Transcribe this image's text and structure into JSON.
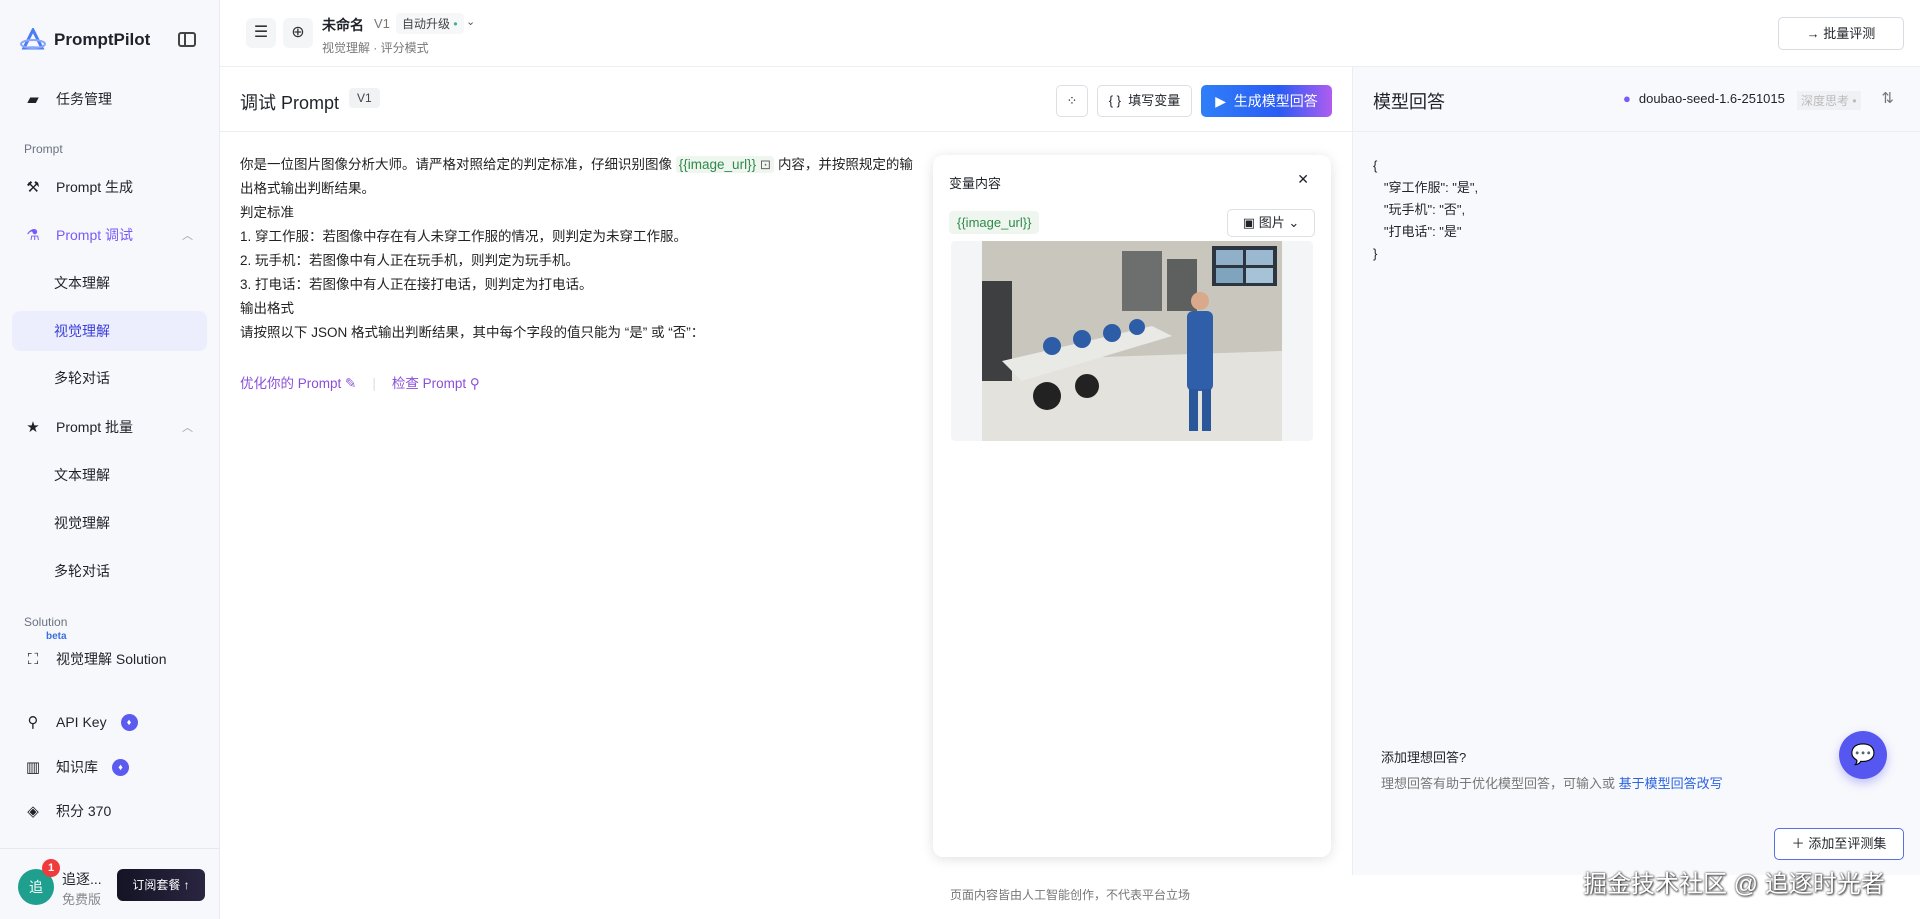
{
  "sidebar": {
    "brand": "PromptPilot",
    "task_mgmt": "任务管理",
    "sec_prompt": "Prompt",
    "prompt_gen": "Prompt 生成",
    "prompt_debug": "Prompt 调试",
    "debug_items": [
      "文本理解",
      "视觉理解",
      "多轮对话"
    ],
    "prompt_batch": "Prompt 批量",
    "batch_items": [
      "文本理解",
      "视觉理解",
      "多轮对话"
    ],
    "sec_solution": "Solution",
    "beta": "beta",
    "vision_solution": "视觉理解 Solution",
    "api_key": "API Key",
    "knowledge": "知识库",
    "points": "积分 370",
    "user": {
      "avatar": "追",
      "badge": "1",
      "name": "追逐...",
      "plan": "免费版",
      "subscribe": "订阅套餐 ↑"
    }
  },
  "topbar": {
    "name": "未命名",
    "version": "V1",
    "auto_upgrade": "自动升级",
    "subtitle": "视觉理解 · 评分模式",
    "batch_eval": "批量评测"
  },
  "editor": {
    "title": "调试 Prompt",
    "version": "V1",
    "fill_vars": "填写变量",
    "generate": "生成模型回答",
    "lines": {
      "l1a": "你是一位图片图像分析大师。请严格对照给定的判定标准，仔细识别图像",
      "var": "{{image_url}}",
      "l1b": "内容，并按照规定的输出格式输出判断结果。",
      "l2": "判定标准",
      "l3": "1. 穿工作服：若图像中存在有人未穿工作服的情况，则判定为未穿工作服。",
      "l4": "2. 玩手机：若图像中有人正在玩手机，则判定为玩手机。",
      "l5": "3. 打电话：若图像中有人正在接打电话，则判定为打电话。",
      "l6": "输出格式",
      "l7": "请按照以下 JSON 格式输出判断结果，其中每个字段的值只能为 “是” 或 “否”："
    },
    "optimize": "优化你的 Prompt",
    "check": "检查 Prompt"
  },
  "variables": {
    "title": "变量内容",
    "var_name": "{{image_url}}",
    "type": "图片"
  },
  "response": {
    "title": "模型回答",
    "model": "doubao-seed-1.6-251015",
    "deep_think": "深度思考",
    "json": "{\n   \"穿工作服\": \"是\",\n   \"玩手机\": \"否\",\n   \"打电话\": \"是\"\n}",
    "ideal_title": "添加理想回答?",
    "ideal_desc": "理想回答有助于优化模型回答，可输入或",
    "ideal_link": "基于模型回答改写",
    "add_to_set": "添加至评测集"
  },
  "footer": "页面内容皆由人工智能创作，不代表平台立场",
  "watermark": "掘金技术社区 @ 追逐时光者"
}
